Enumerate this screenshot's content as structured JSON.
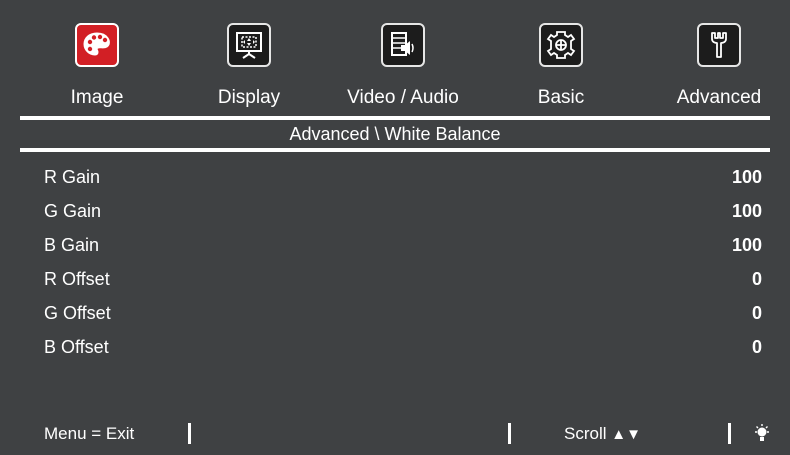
{
  "tabs": [
    {
      "label": "Image",
      "icon": "palette-icon",
      "active": true
    },
    {
      "label": "Display",
      "icon": "screen-icon",
      "active": false
    },
    {
      "label": "Video / Audio",
      "icon": "video-audio-icon",
      "active": false
    },
    {
      "label": "Basic",
      "icon": "gear-icon",
      "active": false
    },
    {
      "label": "Advanced",
      "icon": "wrench-icon",
      "active": false
    }
  ],
  "section_title": "Advanced \\ White Balance",
  "settings": [
    {
      "name": "R Gain",
      "value": "100"
    },
    {
      "name": "G Gain",
      "value": "100"
    },
    {
      "name": "B Gain",
      "value": "100"
    },
    {
      "name": "R Offset",
      "value": "0"
    },
    {
      "name": "G Offset",
      "value": "0"
    },
    {
      "name": "B Offset",
      "value": "0"
    }
  ],
  "footer": {
    "menu_exit": "Menu = Exit",
    "scroll": "Scroll",
    "up_arrow": "▲",
    "down_arrow": "▼",
    "lamp_icon": "lamp-icon"
  },
  "colors": {
    "background": "#3f4143",
    "active_tab": "#d21f25",
    "text": "#ffffff"
  }
}
